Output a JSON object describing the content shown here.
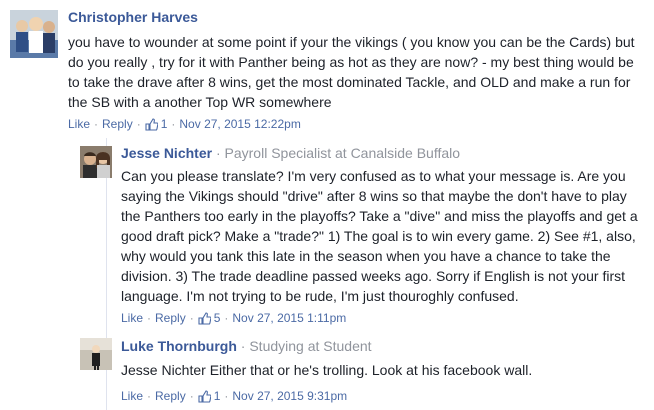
{
  "comments": [
    {
      "author": "Christopher Harves",
      "role": "",
      "text": "you have to wounder at some point if your the vikings ( you know you can be the Cards) but do you really , try for it with Panther being as hot as they are now? - my best thing would be to take the drave after 8 wins, get the most dominated Tackle, and OLD and make a run for the SB with a another Top WR somewhere",
      "like_label": "Like",
      "reply_label": "Reply",
      "likes": "1",
      "timestamp": "Nov 27, 2015 12:22pm"
    },
    {
      "author": "Jesse Nichter",
      "role": "Payroll Specialist at Canalside Buffalo",
      "text": "Can you please translate? I'm very confused as to what your message is. Are you saying the Vikings should \"drive\" after 8 wins so that maybe the don't have to play the Panthers too early in the playoffs? Take a \"dive\" and miss the playoffs and get a good draft pick? Make a \"trade?\" 1) The goal is to win every game. 2) See #1, also, why would you tank this late in the season when you have a chance to take the division. 3) The trade deadline passed weeks ago. Sorry if English is not your first language. I'm not trying to be rude, I'm just thouroghly confused.",
      "like_label": "Like",
      "reply_label": "Reply",
      "likes": "5",
      "timestamp": "Nov 27, 2015 1:11pm"
    },
    {
      "author": "Luke Thornburgh",
      "role": "Studying at Student",
      "text": "Jesse Nichter Either that or he's trolling. Look at his facebook wall.",
      "like_label": "Like",
      "reply_label": "Reply",
      "likes": "1",
      "timestamp": "Nov 27, 2015 9:31pm"
    }
  ],
  "separators": {
    "role_sep": "·",
    "action_sep": "·"
  },
  "colors": {
    "link": "#3b5998",
    "meta": "#90949c",
    "text": "#1d2129"
  },
  "icons": {
    "like": "thumbs-up-icon"
  }
}
